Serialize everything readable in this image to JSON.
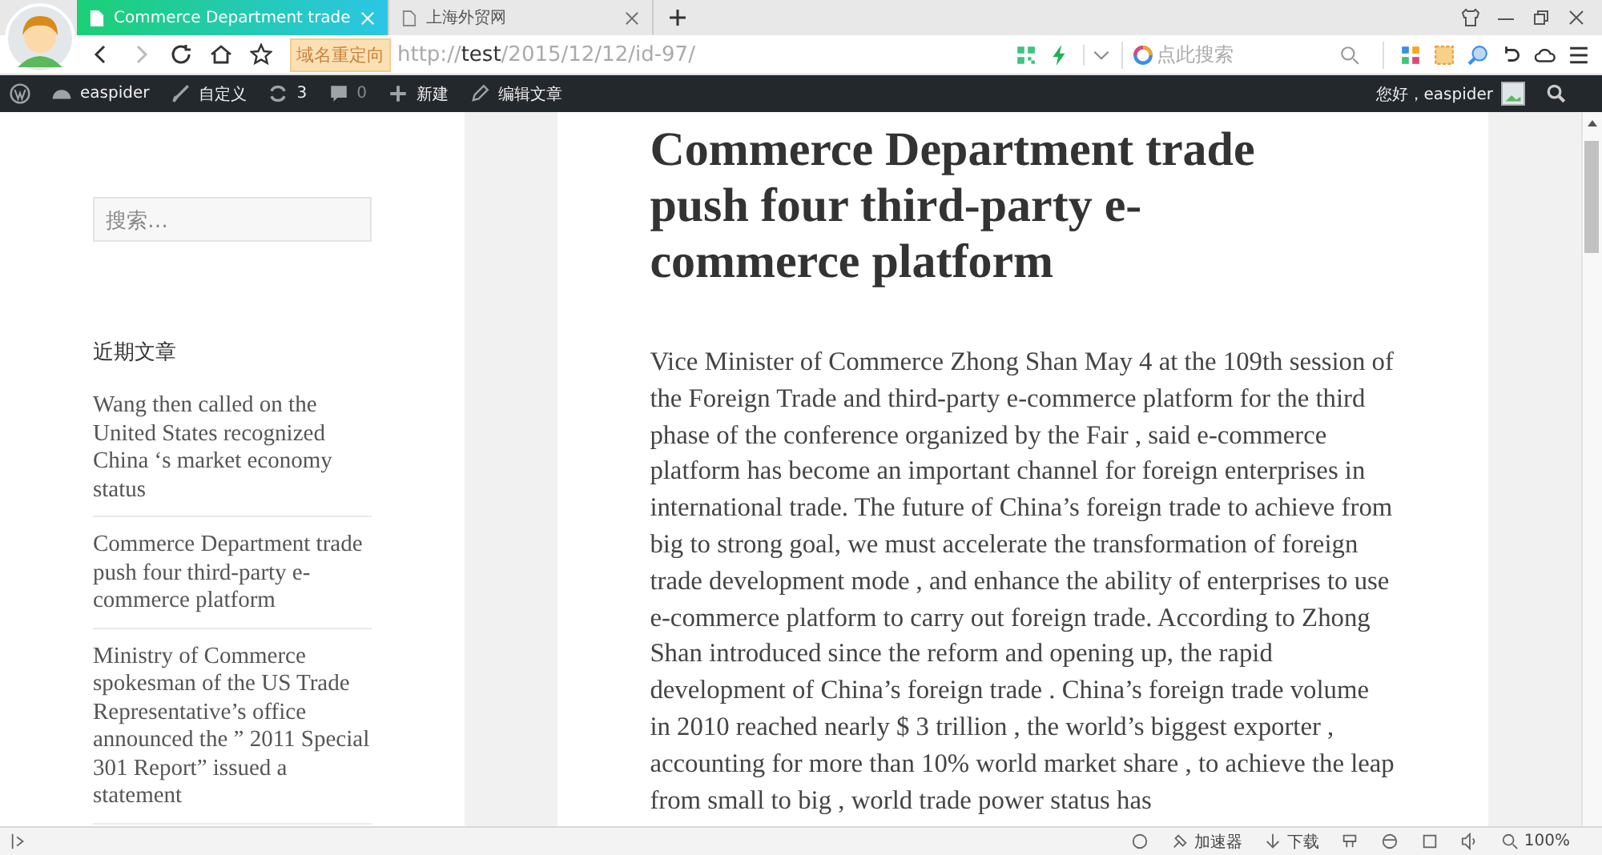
{
  "browser": {
    "tabs": [
      {
        "title": "Commerce Department trade",
        "selected": true
      },
      {
        "title": "上海外贸网",
        "selected": false
      }
    ],
    "redirect_badge": "域名重定向",
    "url": {
      "scheme": "http://",
      "host": "test",
      "path": "/2015/12/12/id-97/"
    },
    "search": {
      "placeholder": "点此搜索"
    }
  },
  "admin_bar": {
    "items": [
      {
        "kind": "wp"
      },
      {
        "kind": "dashboard",
        "label": "easpider"
      },
      {
        "kind": "brush",
        "label": "自定义"
      },
      {
        "kind": "updates",
        "label": "3"
      },
      {
        "kind": "comments",
        "label": "0"
      },
      {
        "kind": "new",
        "label": "新建"
      },
      {
        "kind": "edit",
        "label": "编辑文章"
      }
    ],
    "greeting": "您好，easpider"
  },
  "sidebar": {
    "search": {
      "placeholder": "搜索…"
    },
    "heading": "近期文章",
    "recent_posts": [
      "Wang then called on the United States recognized China ‘s market economy status",
      "Commerce Department trade push four third-party e-commerce platform",
      "Ministry of Commerce spokesman of the US Trade Representative’s office announced the ” 2011 Special 301 Report” issued a statement"
    ]
  },
  "article": {
    "title": "Commerce Department trade push four third-party e-commerce platform",
    "body": "Vice Minister of Commerce Zhong Shan May 4 at the 109th session of the Foreign Trade and third-party e-commerce platform for the third phase of the conference organized by the Fair , said e-commerce platform has become an important channel for foreign enterprises in international trade. The future of China’s foreign trade to achieve from big to strong goal, we must accelerate the transformation of foreign trade development mode , and enhance the ability of enterprises to use e-commerce platform to carry out foreign trade. According to Zhong Shan introduced since the reform and opening up, the rapid development of China’s foreign trade . China’s foreign trade volume in 2010 reached nearly $ 3 trillion , the world’s biggest exporter , accounting for more than 10% world market share , to achieve the leap from small to big , world trade power status has"
  },
  "status_bar": {
    "accelerator": "加速器",
    "download": "下载",
    "zoom": "100%"
  }
}
